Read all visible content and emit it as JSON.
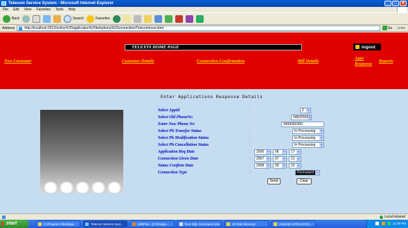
{
  "window": {
    "title": "Telecom Service System - Microsoft Internet Explorer",
    "buttons": [
      "_",
      "□",
      "✕"
    ]
  },
  "menu": [
    "File",
    "Edit",
    "View",
    "Favorites",
    "Tools",
    "Help"
  ],
  "toolbar": {
    "back_label": "Back",
    "search_label": "Search",
    "favorites_label": "Favorites"
  },
  "address": {
    "label": "Address",
    "url": "http://localhost:2012/online%20application%20telephone%20connection/Telecom/new.html",
    "go_label": "Go",
    "links_label": "Links"
  },
  "header": {
    "home_title": "TELEXYS HOME PAGE",
    "logout_label": "logout",
    "nav": {
      "new_customer": "New Customer",
      "customer_details": "Customer Details",
      "connection_confirmation": "Connection Confirmation",
      "bill_details": "Bill Details",
      "apps_response_1": "Apps",
      "apps_response_2": "Response",
      "reports": "Reports"
    }
  },
  "form": {
    "title": "Enter Applications Response Details",
    "colon": ":",
    "fields": {
      "app_id": {
        "label": "Select AppId",
        "value": "2"
      },
      "old_phone": {
        "label": "Select Old PhoneNo",
        "value": "04825555"
      },
      "new_phone": {
        "label": "Enter New Phone No",
        "value": "9494350305"
      },
      "transfer_status": {
        "label": "Select Ph Transfer Status",
        "value": "In Processing"
      },
      "modification_status": {
        "label": "Select Ph Modification Status",
        "value": "In Processing"
      },
      "cancellation_status": {
        "label": "Select Ph Cancellation Status",
        "value": "In Processing"
      },
      "application_req_date": {
        "label": "Application Req Date",
        "year": "2006",
        "month": "06",
        "day": "17"
      },
      "connection_given_date": {
        "label": "Connection Given Date",
        "year": "2007",
        "month": "07",
        "day": "21"
      },
      "status_confirm_date": {
        "label": "Status Confirm Date",
        "year": "2008",
        "month": "09",
        "day": "23"
      },
      "connection_type": {
        "label": "Connection Type",
        "value": "Permanent"
      }
    },
    "send_label": "Send",
    "clear_label": "Clear"
  },
  "status": {
    "zone": "Local intranet"
  },
  "taskbar": {
    "start_label": "start",
    "tasks": [
      "C:\\Program Files\\Spa...",
      "Telecom Service Syst...",
      "EditPlus - [C:\\Progra...",
      "Run SQL Command Line",
      "45 Tele Directory",
      "ONLINE APPLICATIO..."
    ],
    "clock": "11:35 PM"
  }
}
